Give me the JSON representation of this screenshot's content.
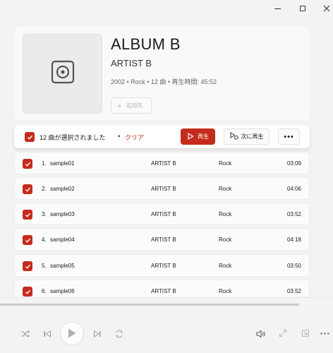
{
  "window": {
    "controls": [
      "minimize-icon",
      "maximize-icon",
      "close-icon"
    ]
  },
  "album": {
    "title": "ALBUM B",
    "artist": "ARTIST B",
    "meta": "2002 • Rock • 12 曲 • 再生時間: 45:52",
    "art_icon": "album-placeholder-icon",
    "add_label": "追加先"
  },
  "selection": {
    "text": "12 曲が選択されました",
    "separator": "•",
    "clear_label": "クリア",
    "play_label": "再生",
    "play_next_label": "次に再生",
    "more_label": "•••",
    "accent": "#c42b1c"
  },
  "tracks": [
    {
      "num": "1.",
      "name": "sample01",
      "artist": "ARTIST B",
      "genre": "Rock",
      "duration": "03:09"
    },
    {
      "num": "2.",
      "name": "sample02",
      "artist": "ARTIST B",
      "genre": "Rock",
      "duration": "04:06"
    },
    {
      "num": "3.",
      "name": "sample03",
      "artist": "ARTIST B",
      "genre": "Rock",
      "duration": "03:52"
    },
    {
      "num": "4.",
      "name": "sample04",
      "artist": "ARTIST B",
      "genre": "Rock",
      "duration": "04:18"
    },
    {
      "num": "5.",
      "name": "sample05",
      "artist": "ARTIST B",
      "genre": "Rock",
      "duration": "03:50"
    },
    {
      "num": "6.",
      "name": "sample06",
      "artist": "ARTIST B",
      "genre": "Rock",
      "duration": "03:52"
    }
  ],
  "player": {
    "icons": [
      "shuffle-icon",
      "previous-icon",
      "play-icon",
      "next-icon",
      "repeat-icon",
      "volume-icon",
      "expand-icon",
      "mini-player-icon",
      "more-icon"
    ],
    "more_label": "•••"
  }
}
